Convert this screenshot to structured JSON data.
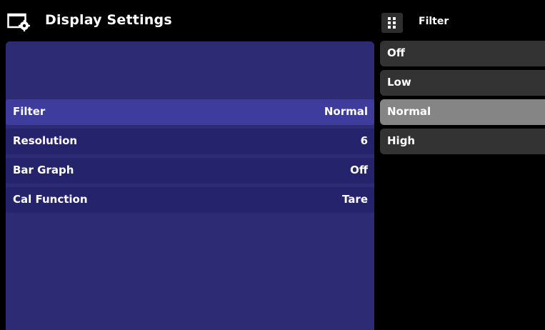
{
  "header": {
    "title": "Display Settings",
    "icon": "display-settings-icon"
  },
  "menu": {
    "title": "Filter",
    "icon": "grip-icon",
    "options": [
      {
        "label": "Off",
        "selected": false
      },
      {
        "label": "Low",
        "selected": false
      },
      {
        "label": "Normal",
        "selected": true
      },
      {
        "label": "High",
        "selected": false
      }
    ]
  },
  "settings": {
    "rows": [
      {
        "label": "Filter",
        "value": "Normal",
        "selected": true
      },
      {
        "label": "Resolution",
        "value": "6",
        "selected": false
      },
      {
        "label": "Bar Graph",
        "value": "Off",
        "selected": false
      },
      {
        "label": "Cal Function",
        "value": "Tare",
        "selected": false
      }
    ]
  },
  "colors": {
    "panel": "#2d2b73",
    "row": "#25236b",
    "row_selected": "#3e3c9c",
    "option": "#333333",
    "option_selected": "#858585"
  }
}
